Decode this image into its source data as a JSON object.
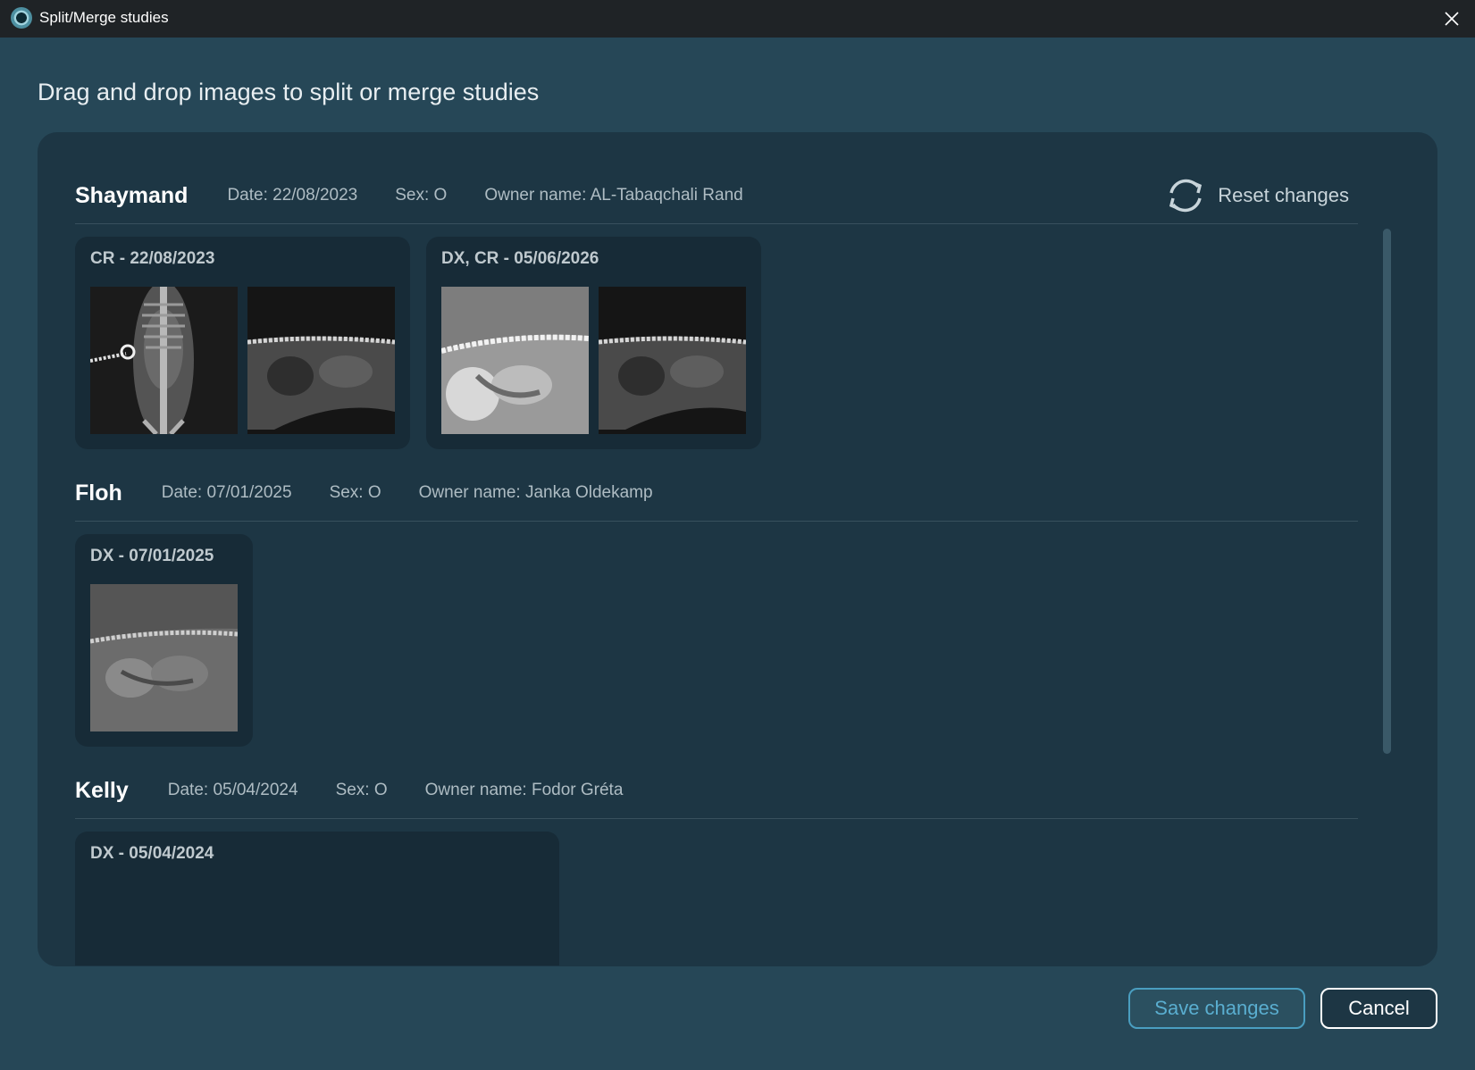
{
  "window": {
    "title": "Split/Merge studies",
    "close_icon": "close-icon"
  },
  "instruction": "Drag and drop images to split or merge studies",
  "reset": {
    "label": "Reset changes",
    "icon": "refresh-icon"
  },
  "patients": [
    {
      "name": "Shaymand",
      "date": "Date: 22/08/2023",
      "sex": "Sex: O",
      "owner": "Owner name: AL-Tabaqchali Rand",
      "studies": [
        {
          "title": "CR - 22/08/2023",
          "images": [
            "xray-ventrodorsal",
            "xray-lateral-dark"
          ]
        },
        {
          "title": "DX, CR - 05/06/2026",
          "images": [
            "xray-lateral-bright",
            "xray-lateral-dark"
          ]
        }
      ]
    },
    {
      "name": "Floh",
      "date": "Date: 07/01/2025",
      "sex": "Sex: O",
      "owner": "Owner name: Janka Oldekamp",
      "studies": [
        {
          "title": "DX - 07/01/2025",
          "images": [
            "xray-lateral-grey"
          ]
        }
      ]
    },
    {
      "name": "Kelly",
      "date": "Date: 05/04/2024",
      "sex": "Sex: O",
      "owner": "Owner name: Fodor Gréta",
      "studies": [
        {
          "title": "DX - 05/04/2024",
          "images": []
        }
      ]
    }
  ],
  "buttons": {
    "save": "Save changes",
    "cancel": "Cancel"
  },
  "colors": {
    "background": "#264757",
    "panel": "#1d3644",
    "card": "#172b37",
    "accent": "#4a9ec0",
    "titlebar": "#1f2326"
  }
}
